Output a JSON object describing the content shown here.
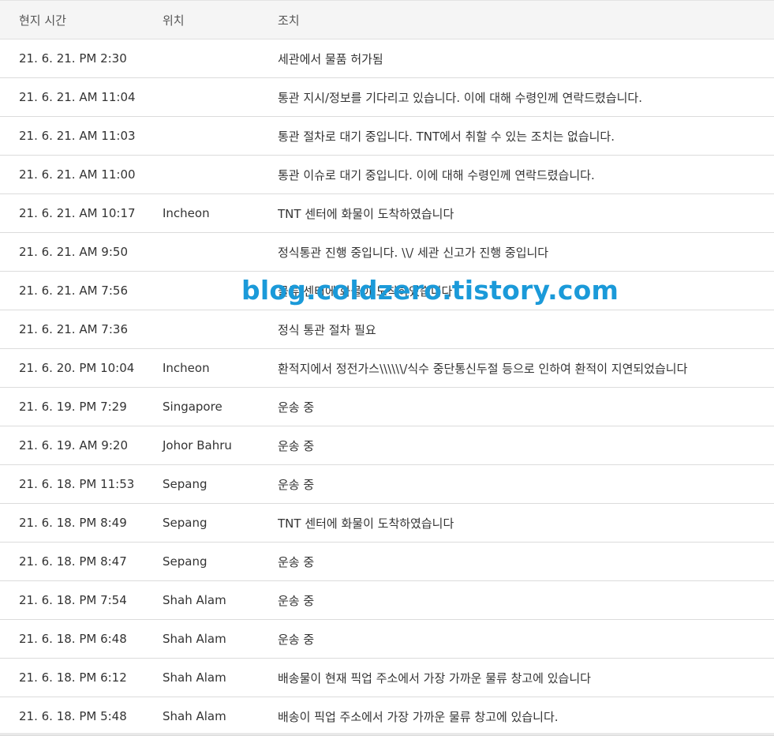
{
  "header": {
    "time": "현지 시간",
    "location": "위치",
    "action": "조치"
  },
  "rows": [
    {
      "time": "21. 6. 21. PM 2:30",
      "location": "",
      "action": "세관에서 물품 허가됨"
    },
    {
      "time": "21. 6. 21. AM 11:04",
      "location": "",
      "action": "통관 지시/정보를 기다리고 있습니다. 이에 대해 수령인께 연락드렸습니다."
    },
    {
      "time": "21. 6. 21. AM 11:03",
      "location": "",
      "action": "통관 절차로 대기 중입니다. TNT에서 취할 수 있는 조치는 없습니다."
    },
    {
      "time": "21. 6. 21. AM 11:00",
      "location": "",
      "action": "통관 이슈로 대기 중입니다. 이에 대해 수령인께 연락드렸습니다."
    },
    {
      "time": "21. 6. 21. AM 10:17",
      "location": "Incheon",
      "action": "TNT 센터에 화물이 도착하였습니다"
    },
    {
      "time": "21. 6. 21. AM 9:50",
      "location": "",
      "action": "정식통관 진행 중입니다. \\\\/ 세관 신고가 진행 중입니다"
    },
    {
      "time": "21. 6. 21. AM 7:56",
      "location": "",
      "action": "물류 센터에 화물이 도착하였습니다"
    },
    {
      "time": "21. 6. 21. AM 7:36",
      "location": "",
      "action": "정식 통관 절차 필요"
    },
    {
      "time": "21. 6. 20. PM 10:04",
      "location": "Incheon",
      "action": "환적지에서 정전가스\\\\\\\\\\\\/식수 중단통신두절 등으로 인하여 환적이 지연되었습니다"
    },
    {
      "time": "21. 6. 19. PM 7:29",
      "location": "Singapore",
      "action": "운송 중"
    },
    {
      "time": "21. 6. 19. AM 9:20",
      "location": "Johor Bahru",
      "action": "운송 중"
    },
    {
      "time": "21. 6. 18. PM 11:53",
      "location": "Sepang",
      "action": "운송 중"
    },
    {
      "time": "21. 6. 18. PM 8:49",
      "location": "Sepang",
      "action": "TNT 센터에 화물이 도착하였습니다"
    },
    {
      "time": "21. 6. 18. PM 8:47",
      "location": "Sepang",
      "action": "운송 중"
    },
    {
      "time": "21. 6. 18. PM 7:54",
      "location": "Shah Alam",
      "action": "운송 중"
    },
    {
      "time": "21. 6. 18. PM 6:48",
      "location": "Shah Alam",
      "action": "운송 중"
    },
    {
      "time": "21. 6. 18. PM 6:12",
      "location": "Shah Alam",
      "action": "배송물이 현재 픽업 주소에서 가장 가까운 물류 창고에 있습니다"
    },
    {
      "time": "21. 6. 18. PM 5:48",
      "location": "Shah Alam",
      "action": "배송이 픽업 주소에서 가장 가까운 물류 창고에 있습니다."
    }
  ],
  "watermark": "blog.coldzero.tistory.com",
  "colors": {
    "watermark": "#1b9ad9",
    "header_bg": "#f5f5f5",
    "row_border": "#dcdcdc"
  }
}
